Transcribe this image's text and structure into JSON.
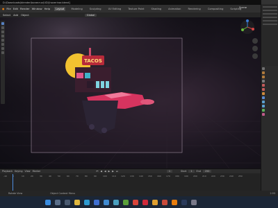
{
  "window": {
    "title": "D:\\Downloads\\blender\\bonecrux(UD)\\hoverinar.blend]"
  },
  "menu": {
    "items": [
      "File",
      "Edit",
      "Render",
      "Window",
      "Help"
    ],
    "workspaces": [
      "Layout",
      "Modeling",
      "Sculpting",
      "UV Editing",
      "Texture Paint",
      "Shading",
      "Animation",
      "Rendering",
      "Compositing",
      "Scripting"
    ],
    "active_workspace": "Layout",
    "scene": "Scene"
  },
  "viewport_header": {
    "select": "Select",
    "add": "Add",
    "object": "Object",
    "orientation": "Global"
  },
  "viewport": {
    "sign_text": "TACOS",
    "accent": "#c9c9d8",
    "sun": "#f2c230",
    "sign_bg": "#b72a3a",
    "car": "#d6345f",
    "tile": "#7fd3e0"
  },
  "timeline": {
    "header": [
      "Playback",
      "Keying",
      "View",
      "Marker"
    ],
    "ticks": [
      "-10",
      "0",
      "10",
      "20",
      "30",
      "40",
      "50",
      "60",
      "70",
      "80",
      "90",
      "100",
      "110",
      "120",
      "130",
      "140",
      "150",
      "160",
      "170",
      "180",
      "190",
      "200",
      "210",
      "220",
      "230",
      "240",
      "250"
    ],
    "current_frame": "1",
    "start_label": "Start",
    "start": "1",
    "end_label": "End",
    "end": "250"
  },
  "status": {
    "left": "Rotate View",
    "mid": "Object Context Menu",
    "right": "2.93"
  },
  "taskbar": {
    "icons": [
      "windows-icon",
      "search-icon",
      "taskview-icon",
      "files-icon",
      "edge-icon",
      "store-icon",
      "mail-icon",
      "photos-icon",
      "xbox-icon",
      "chrome-icon",
      "opera-icon",
      "folder-icon",
      "media-icon",
      "blender-icon",
      "steam-icon",
      "settings-icon"
    ]
  }
}
